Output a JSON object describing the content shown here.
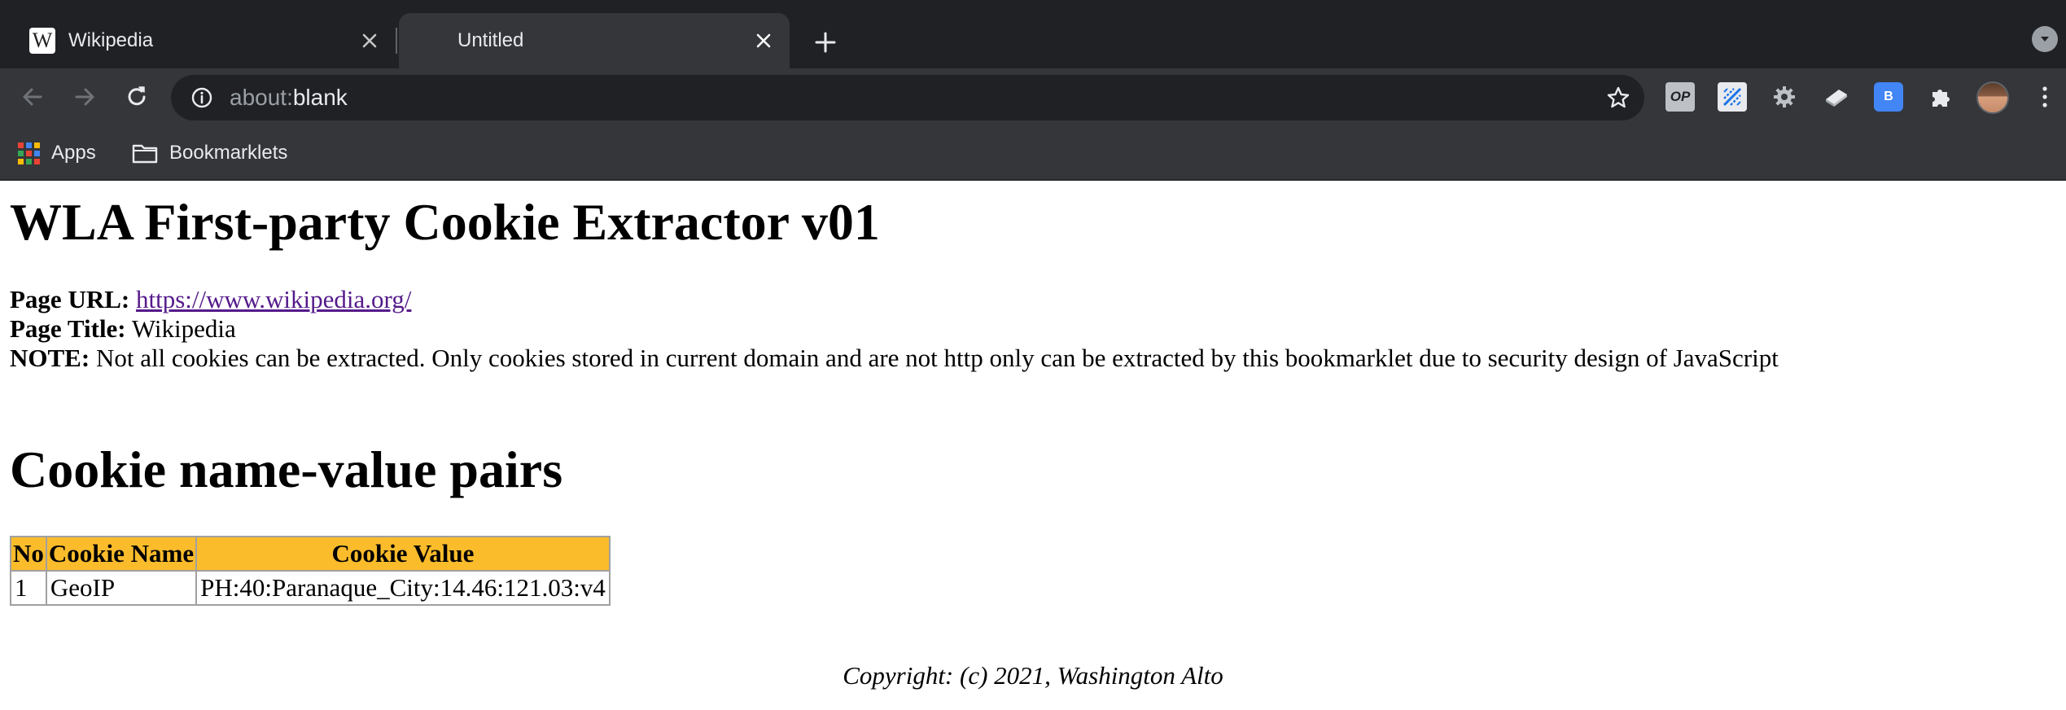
{
  "browser": {
    "tabs": [
      {
        "title": "Wikipedia",
        "favicon": "W",
        "active": false
      },
      {
        "title": "Untitled",
        "active": true
      }
    ],
    "address_bar": {
      "scheme": "about:",
      "rest": "blank"
    },
    "extensions": [
      {
        "label": "OP",
        "icon": "op-extension-icon"
      },
      {
        "icon": "diagonal-pattern-extension-icon"
      },
      {
        "icon": "gear-extension-icon"
      },
      {
        "icon": "eraser-extension-icon"
      },
      {
        "label": "B",
        "icon": "bracket-b-extension-icon"
      },
      {
        "icon": "puzzle-piece-icon"
      }
    ],
    "bookmarks": [
      {
        "label": "Apps",
        "icon": "apps-grid-icon"
      },
      {
        "label": "Bookmarklets",
        "icon": "folder-icon"
      }
    ],
    "colors": {
      "tabstrip": "#202124",
      "toolbar": "#35363a",
      "text": "#e8eaed"
    }
  },
  "page": {
    "title": "WLA First-party Cookie Extractor v01",
    "page_url_label": "Page URL:",
    "page_url": "https://www.wikipedia.org/",
    "page_title_label": "Page Title:",
    "page_title": "Wikipedia",
    "note_label": "NOTE:",
    "note": "Not all cookies can be extracted. Only cookies stored in current domain and are not http only can be extracted by this bookmarklet due to security design of JavaScript",
    "section_heading": "Cookie name-value pairs",
    "table": {
      "headers": [
        "No",
        "Cookie Name",
        "Cookie Value"
      ],
      "rows": [
        [
          "1",
          "GeoIP",
          "PH:40:Paranaque_City:14.46:121.03:v4"
        ]
      ],
      "header_color": "#fbbc2c"
    },
    "copyright": "Copyright: (c) 2021, Washington Alto"
  }
}
